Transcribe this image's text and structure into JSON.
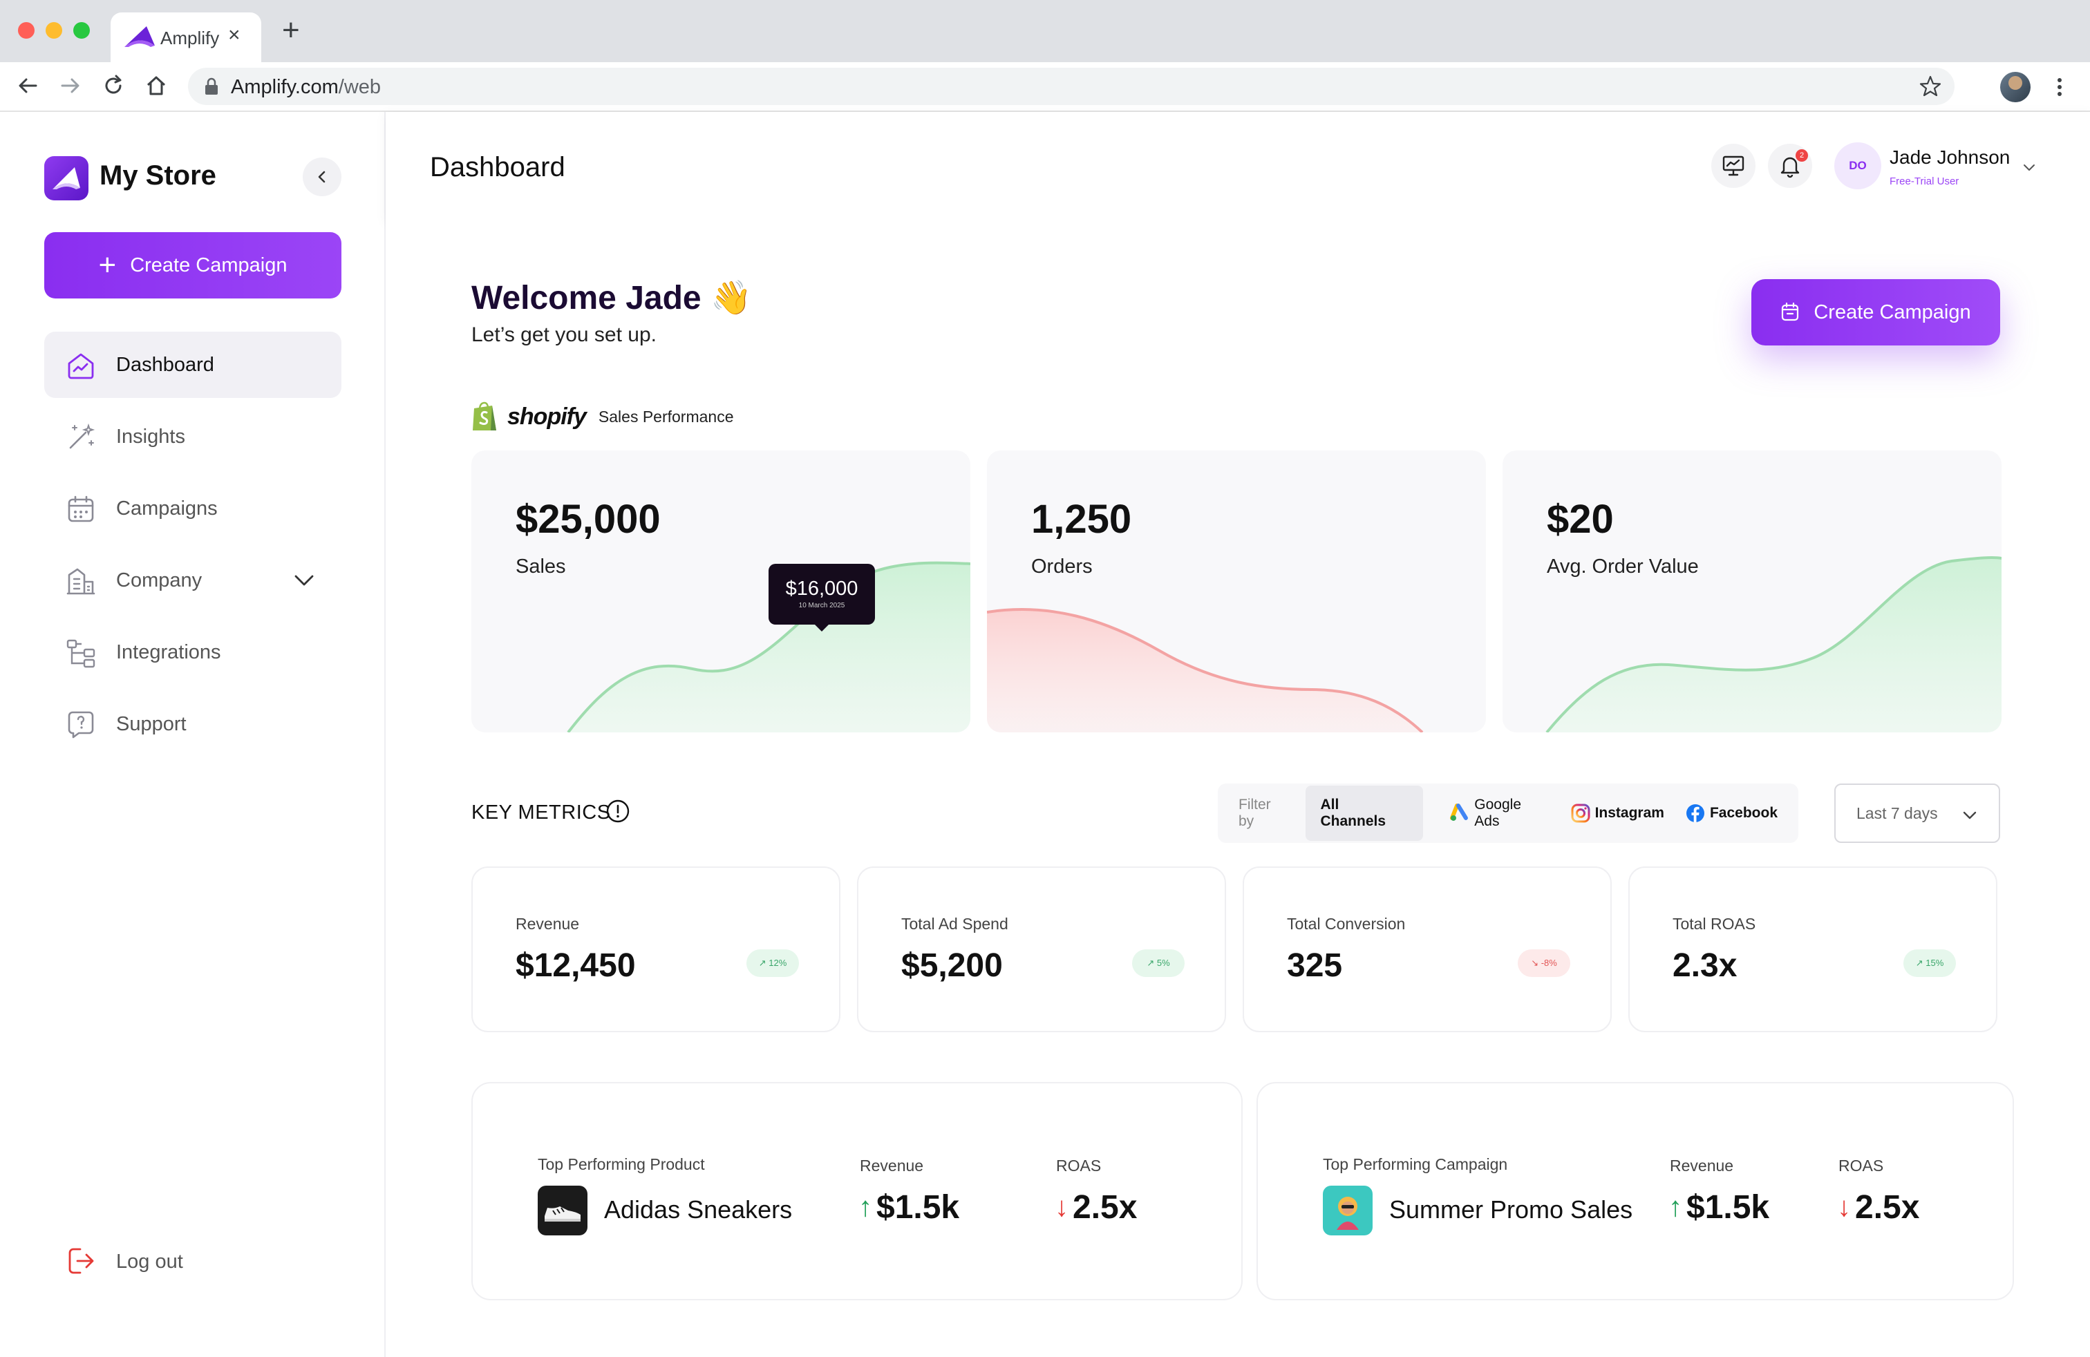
{
  "browser": {
    "tab_title": "Amplify",
    "tab_close": "×",
    "new_tab": "+",
    "url_host": "Amplify.com",
    "url_path": "/web"
  },
  "sidebar": {
    "store_name": "My Store",
    "create_campaign": "Create Campaign",
    "items": [
      {
        "label": "Dashboard",
        "icon": "dashboard-icon",
        "active": true
      },
      {
        "label": "Insights",
        "icon": "magic-wand-icon"
      },
      {
        "label": "Campaigns",
        "icon": "calendar-icon"
      },
      {
        "label": "Company",
        "icon": "building-icon",
        "expandable": true
      },
      {
        "label": "Integrations",
        "icon": "flow-icon"
      },
      {
        "label": "Support",
        "icon": "chat-question-icon"
      }
    ],
    "logout": "Log out"
  },
  "header": {
    "title": "Dashboard",
    "notification_count": "2",
    "user": {
      "initials": "DO",
      "name": "Jade Johnson",
      "role": "Free-Trial User"
    }
  },
  "welcome": {
    "title": "Welcome Jade 👋",
    "subtitle": "Let’s get you set up.",
    "create_campaign": "Create Campaign"
  },
  "sales_performance": {
    "brand": "shopify",
    "label": "Sales Performance",
    "cards": [
      {
        "value": "$25,000",
        "label": "Sales",
        "trend": "up",
        "tooltip": {
          "value": "$16,000",
          "date": "10 March 2025"
        }
      },
      {
        "value": "1,250",
        "label": "Orders",
        "trend": "down"
      },
      {
        "value": "$20",
        "label": "Avg. Order Value",
        "trend": "up"
      }
    ]
  },
  "key_metrics": {
    "title": "KEY METRICS",
    "filter_label": "Filter by",
    "channels": [
      "All Channels",
      "Google Ads",
      "Instagram",
      "Facebook"
    ],
    "date_range": "Last 7 days",
    "metrics": [
      {
        "label": "Revenue",
        "value": "$12,450",
        "change": "↗ 12%",
        "direction": "up"
      },
      {
        "label": "Total Ad Spend",
        "value": "$5,200",
        "change": "↗ 5%",
        "direction": "up"
      },
      {
        "label": "Total Conversion",
        "value": "325",
        "change": "↘ -8%",
        "direction": "down"
      },
      {
        "label": "Total ROAS",
        "value": "2.3x",
        "change": "↗ 15%",
        "direction": "up"
      }
    ]
  },
  "top_performers": [
    {
      "heading": "Top Performing Product",
      "name": "Adidas Sneakers",
      "revenue_label": "Revenue",
      "revenue": "$1.5k",
      "revenue_dir": "↑",
      "roas_label": "ROAS",
      "roas": "2.5x",
      "roas_dir": "↓"
    },
    {
      "heading": "Top Performing Campaign",
      "name": "Summer Promo Sales",
      "revenue_label": "Revenue",
      "revenue": "$1.5k",
      "revenue_dir": "↑",
      "roas_label": "ROAS",
      "roas": "2.5x",
      "roas_dir": "↓"
    }
  ],
  "colors": {
    "accent": "#8a2ef0",
    "positive": "#22a05a",
    "negative": "#e53935",
    "chart_up": "#a7e3b5",
    "chart_down": "#f5a6a6"
  }
}
